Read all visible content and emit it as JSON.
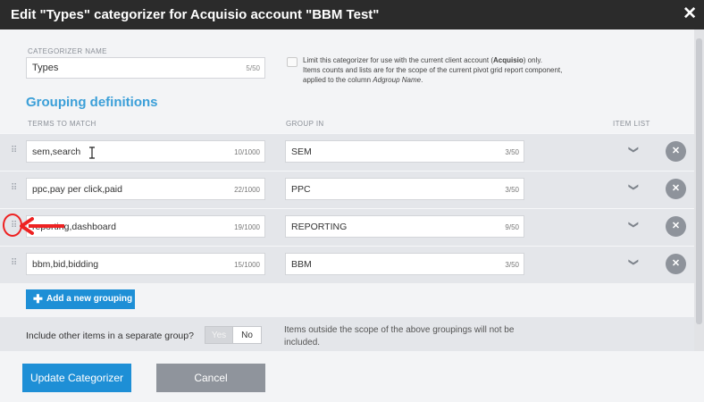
{
  "dialog": {
    "title": "Edit \"Types\" categorizer for Acquisio account \"BBM Test\"",
    "close_icon": "close-icon",
    "close_glyph": "✕"
  },
  "categorizer_name": {
    "label": "CATEGORIZER NAME",
    "value": "Types",
    "count": "5/50"
  },
  "limit": {
    "line1_pre": "Limit this categorizer for use with the current client account (",
    "line1_bold": "Acquisio",
    "line1_post": ") only.",
    "line2": "Items counts and lists are for the scope of the current pivot grid report component,",
    "line3_pre": "applied to the column ",
    "line3_italic": "Adgroup Name",
    "line3_post": "."
  },
  "grouping": {
    "title": "Grouping definitions",
    "col_terms": "TERMS TO MATCH",
    "col_group": "GROUP IN",
    "col_items": "ITEM LIST",
    "rows": [
      {
        "terms": "sem,search",
        "terms_count": "10/1000",
        "group": "SEM",
        "group_count": "3/50"
      },
      {
        "terms": "ppc,pay per click,paid",
        "terms_count": "22/1000",
        "group": "PPC",
        "group_count": "3/50"
      },
      {
        "terms": "reporting,dashboard",
        "terms_count": "19/1000",
        "group": "REPORTING",
        "group_count": "9/50"
      },
      {
        "terms": "bbm,bid,bidding",
        "terms_count": "15/1000",
        "group": "BBM",
        "group_count": "3/50"
      }
    ],
    "add_label": "Add a new grouping"
  },
  "include": {
    "label": "Include other items in a separate group?",
    "yes": "Yes",
    "no": "No",
    "note": "Items outside the scope of the above groupings will not be included."
  },
  "footer": {
    "update": "Update Categorizer",
    "cancel": "Cancel"
  },
  "colors": {
    "accent": "#1e8fd6",
    "title_blue": "#3b9fd8",
    "annotation_red": "#e22222"
  }
}
